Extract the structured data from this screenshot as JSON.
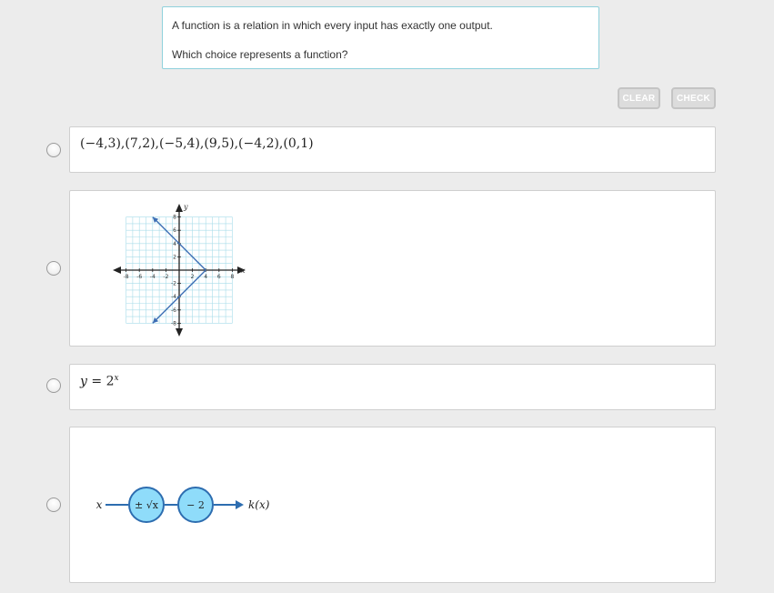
{
  "prompt": {
    "line1": "A function is a relation in which every input has exactly one output.",
    "line2": "Which choice represents a function?"
  },
  "buttons": {
    "clear": "CLEAR",
    "check": "CHECK"
  },
  "choices": {
    "a": {
      "text": "(−4,3),(7,2),(−5,4),(9,5),(−4,2),(0,1)"
    },
    "b": {
      "graph": {
        "x_label": "x",
        "y_label": "y",
        "x_ticks": [
          "-8",
          "-6",
          "-4",
          "-2",
          "2",
          "4",
          "6",
          "8"
        ],
        "y_ticks": [
          "8",
          "6",
          "4",
          "2",
          "-2",
          "-4",
          "-6",
          "-8"
        ],
        "lines": [
          {
            "from": [
              -4,
              8
            ],
            "to": [
              4,
              0
            ]
          },
          {
            "from": [
              4,
              0
            ],
            "to": [
              -4,
              -8
            ]
          }
        ]
      }
    },
    "c": {
      "lhs": "y",
      "eq": " = ",
      "base": "2",
      "exp": "x"
    },
    "d": {
      "input": "x",
      "op1": "± √x",
      "op2": "− 2",
      "output": "k(x)",
      "colors": {
        "node_fill": "#8fdcfa",
        "stroke": "#2d6db0"
      }
    }
  }
}
